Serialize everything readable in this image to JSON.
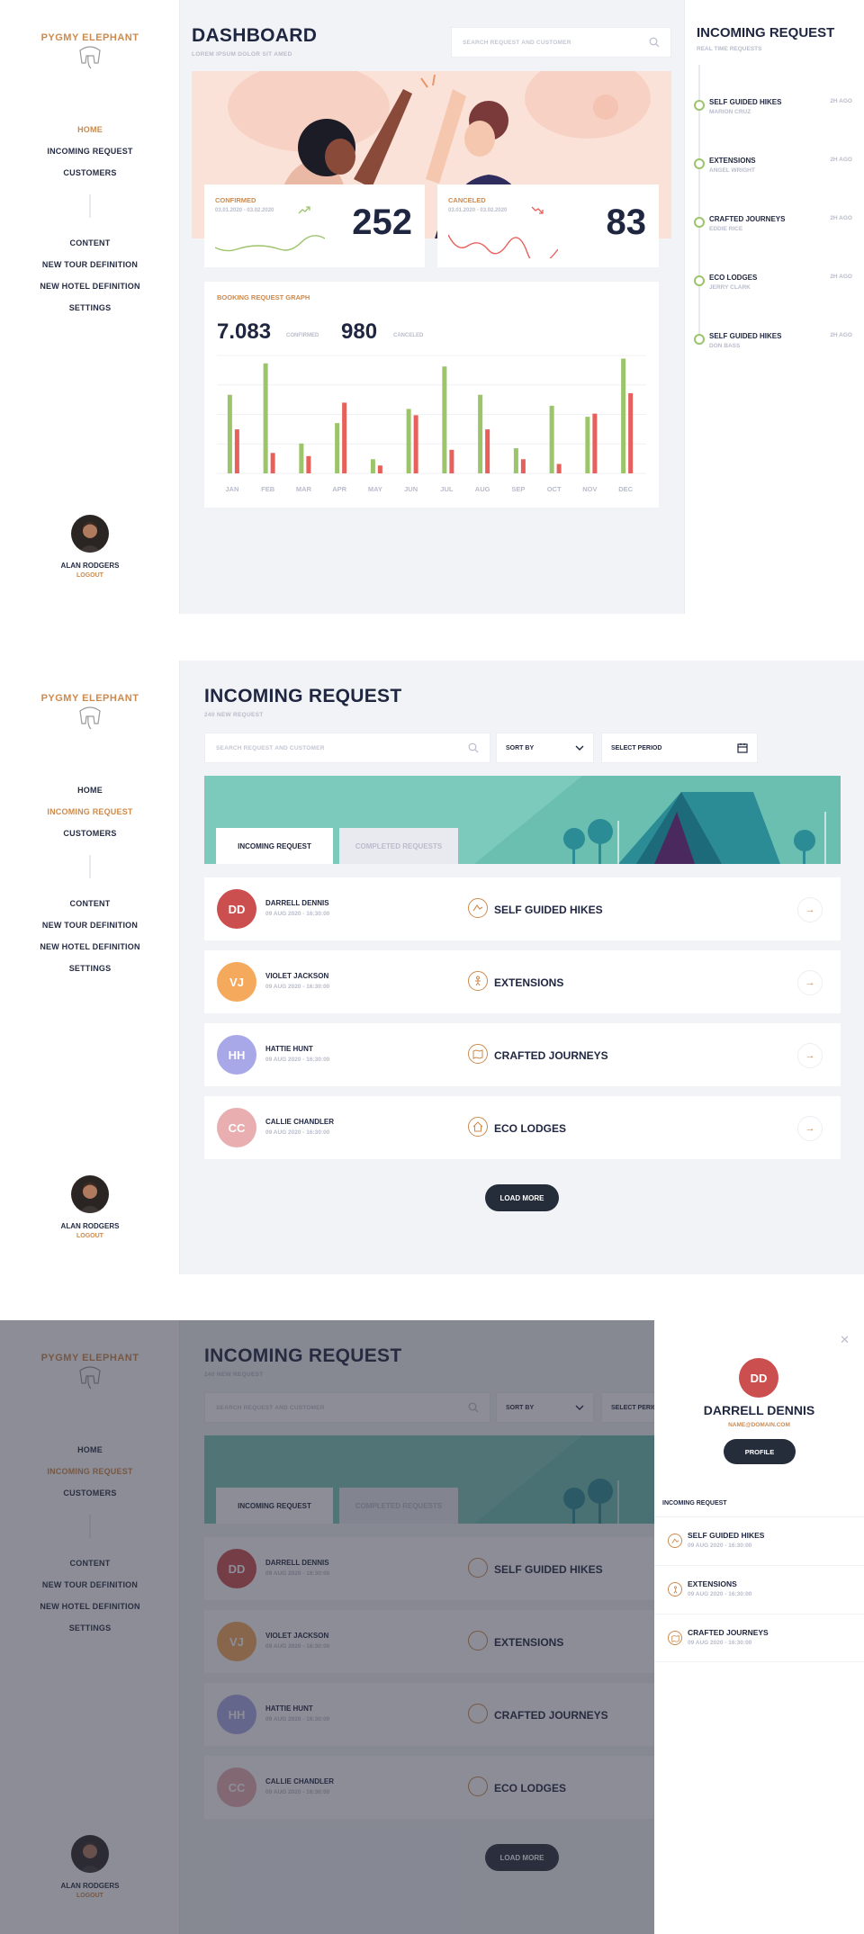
{
  "brand": {
    "logo_text": "PYGMY ELEPHANT"
  },
  "nav": {
    "primary": [
      "HOME",
      "INCOMING REQUEST",
      "CUSTOMERS"
    ],
    "secondary": [
      "CONTENT",
      "NEW TOUR DEFINITION",
      "NEW HOTEL DEFINITION",
      "SETTINGS"
    ]
  },
  "user": {
    "name": "ALAN RODGERS",
    "logout": "LOGOUT"
  },
  "dashboard": {
    "title": "DASHBOARD",
    "subtitle": "LOREM IPSUM DOLOR SIT AMED",
    "search_placeholder": "SEARCH REQUEST AND CUSTOMER",
    "confirmed": {
      "label": "CONFIRMED",
      "dates": "03.01.2020 - 03.02.2020",
      "value": "252"
    },
    "canceled": {
      "label": "CANCELED",
      "dates": "03.01.2020 - 03.02.2020",
      "value": "83"
    },
    "graph": {
      "title": "BOOKING REQUEST GRAPH",
      "confirmed_total": "7.083",
      "confirmed_label": "CONFIRMED",
      "canceled_total": "980",
      "canceled_label": "CANCELED"
    }
  },
  "incoming_panel": {
    "title": "INCOMING REQUEST",
    "subtitle": "REAL TIME REQUESTS",
    "items": [
      {
        "title": "SELF GUIDED HIKES",
        "name": "MARION CRUZ",
        "time": "2H AGO"
      },
      {
        "title": "EXTENSIONS",
        "name": "ANGEL WRIGHT",
        "time": "2H AGO"
      },
      {
        "title": "CRAFTED JOURNEYS",
        "name": "EDDIE RICE",
        "time": "2H AGO"
      },
      {
        "title": "ECO LODGES",
        "name": "JERRY CLARK",
        "time": "2H AGO"
      },
      {
        "title": "SELF GUIDED HIKES",
        "name": "DON BASS",
        "time": "2H AGO"
      }
    ]
  },
  "requests": {
    "title": "INCOMING REQUEST",
    "subtitle": "240 NEW REQUEST",
    "search_placeholder": "SEARCH REQUEST AND CUSTOMER",
    "sort_label": "SORT BY",
    "period_label": "SELECT PERIOD",
    "tabs": [
      "INCOMING REQUEST",
      "COMPLETED REQUESTS"
    ],
    "rows": [
      {
        "initials": "DD",
        "name": "DARRELL DENNIS",
        "date": "09 AUG 2020 - 16:30:00",
        "category": "SELF GUIDED HIKES",
        "color": "#cc4f4f"
      },
      {
        "initials": "VJ",
        "name": "VIOLET JACKSON",
        "date": "09 AUG 2020 - 16:30:00",
        "category": "EXTENSIONS",
        "color": "#f4a95c"
      },
      {
        "initials": "HH",
        "name": "HATTIE HUNT",
        "date": "09 AUG 2020 - 16:30:00",
        "category": "CRAFTED JOURNEYS",
        "color": "#a8a8e8"
      },
      {
        "initials": "CC",
        "name": "CALLIE CHANDLER",
        "date": "09 AUG 2020 - 16:30:00",
        "category": "ECO LODGES",
        "color": "#e8aeb0"
      }
    ],
    "load_more": "LOAD MORE"
  },
  "drawer": {
    "initials": "DD",
    "name": "DARRELL DENNIS",
    "email": "NAME@DOMAIN.COM",
    "profile_button": "PROFILE",
    "section_title": "INCOMING REQUEST",
    "items": [
      {
        "title": "SELF GUIDED HIKES",
        "date": "09 AUG 2020 - 16:30:00"
      },
      {
        "title": "EXTENSIONS",
        "date": "09 AUG 2020 - 16:30:00"
      },
      {
        "title": "CRAFTED JOURNEYS",
        "date": "09 AUG 2020 - 16:30:00"
      }
    ]
  },
  "chart_data": {
    "type": "bar",
    "title": "BOOKING REQUEST GRAPH",
    "categories": [
      "JAN",
      "FEB",
      "MAR",
      "APR",
      "MAY",
      "JUN",
      "JUL",
      "AUG",
      "SEP",
      "OCT",
      "NOV",
      "DEC"
    ],
    "series": [
      {
        "name": "CONFIRMED",
        "color": "#9bc46b",
        "values": [
          50,
          70,
          19,
          32,
          9,
          41,
          68,
          50,
          16,
          43,
          36,
          73
        ]
      },
      {
        "name": "CANCELED",
        "color": "#e8605c",
        "values": [
          28,
          13,
          11,
          45,
          5,
          37,
          15,
          28,
          9,
          6,
          38,
          51
        ]
      }
    ],
    "ylim": [
      0,
      75
    ],
    "grid": true,
    "xlabel": "",
    "ylabel": ""
  },
  "colors": {
    "accent": "#cc8a4d",
    "confirmed": "#9bc46b",
    "canceled": "#e8605c",
    "dark": "#1f2640"
  }
}
